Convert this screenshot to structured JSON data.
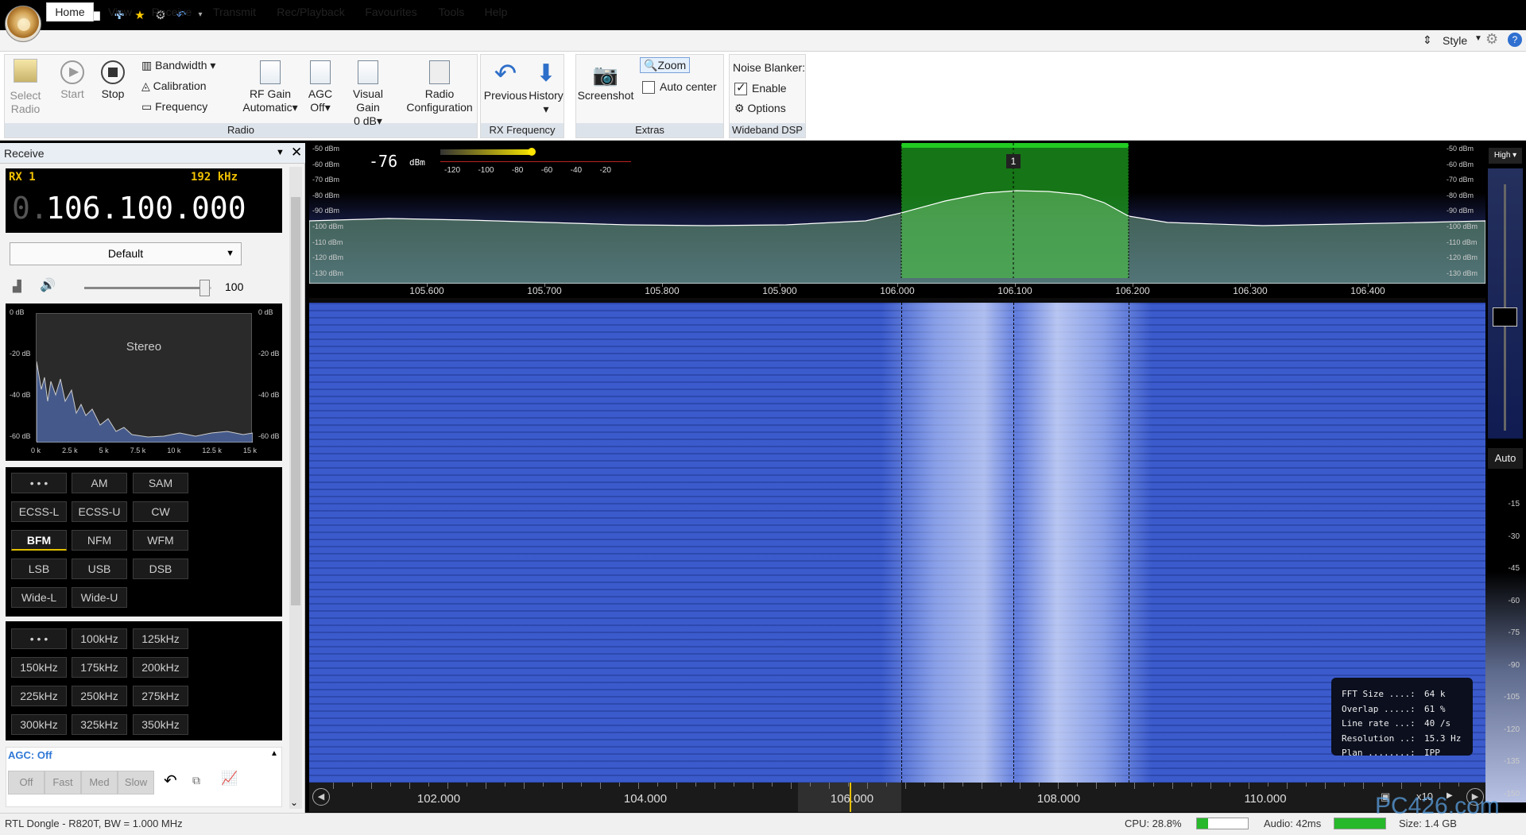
{
  "titlebar": {
    "quick_access": [
      "open-folder-icon",
      "play-icon",
      "stop-icon",
      "add-icon",
      "favourite-star-icon",
      "settings-icon",
      "undo-icon",
      "dropdown-icon"
    ]
  },
  "tabs": [
    "Home",
    "View",
    "Receive",
    "Transmit",
    "Rec/Playback",
    "Favourites",
    "Tools",
    "Help"
  ],
  "style_label": "Style",
  "ribbon": {
    "radio": {
      "select": "Select\nRadio",
      "start": "Start",
      "stop": "Stop",
      "bandwidth": "Bandwidth",
      "calibration": "Calibration",
      "frequency": "Frequency",
      "rfgain": "RF Gain",
      "rfgain_val": "Automatic",
      "agc": "AGC",
      "agc_val": "Off",
      "visual": "Visual Gain",
      "visual_val": "0 dB",
      "config1": "Radio",
      "config2": "Configuration",
      "group": "Radio"
    },
    "rx": {
      "previous": "Previous",
      "history": "History",
      "group": "RX Frequency"
    },
    "extras": {
      "screenshot": "Screenshot",
      "zoom": "Zoom",
      "autocenter": "Auto center",
      "group": "Extras"
    },
    "dsp": {
      "title": "Noise Blanker:",
      "enable": "Enable",
      "options": "Options",
      "group": "Wideband DSP"
    }
  },
  "receive": {
    "title": "Receive",
    "rx": "RX 1",
    "bw": "192 kHz",
    "freq_prefix": "0.",
    "freq": "106.100.000",
    "preset": "Default",
    "volume": "100",
    "volume_level": 0.95,
    "audio_spectrum": {
      "label": "Stereo",
      "left_ticks": [
        "0 dB",
        "-20 dB",
        "-40 dB",
        "-60 dB"
      ],
      "right_ticks": [
        "0 dB",
        "-20 dB",
        "-40 dB",
        "-60 dB"
      ],
      "x_ticks": [
        "0 k",
        "2.5 k",
        "5 k",
        "7.5 k",
        "10 k",
        "12.5 k",
        "15 k"
      ]
    },
    "modes": [
      "• • •",
      "AM",
      "SAM",
      "ECSS-L",
      "ECSS-U",
      "CW",
      "BFM",
      "NFM",
      "WFM",
      "LSB",
      "USB",
      "DSB",
      "Wide-L",
      "Wide-U"
    ],
    "selected_mode": "BFM",
    "steps": [
      "• • •",
      "100kHz",
      "125kHz",
      "150kHz",
      "175kHz",
      "200kHz",
      "225kHz",
      "250kHz",
      "275kHz",
      "300kHz",
      "325kHz",
      "350kHz"
    ],
    "agc": {
      "title": "AGC: Off",
      "buttons": [
        "Off",
        "Fast",
        "Med",
        "Slow"
      ]
    }
  },
  "spectrum": {
    "level": "-76",
    "level_unit": "dBm",
    "meter_ticks": [
      "-120",
      "-100",
      "-80",
      "-60",
      "-40",
      "-20"
    ],
    "db_ticks": [
      "-50 dBm",
      "-60 dBm",
      "-70 dBm",
      "-80 dBm",
      "-90 dBm",
      "-100 dBm",
      "-110 dBm",
      "-120 dBm",
      "-130 dBm"
    ],
    "freq_ticks": [
      "105.600",
      "105.700",
      "105.800",
      "105.900",
      "106.000",
      "106.100",
      "106.200",
      "106.300",
      "106.400"
    ],
    "marker": "1",
    "range_label": "High ▾"
  },
  "waterfall": {
    "freq_ticks": [
      "102.000",
      "104.000",
      "106.000",
      "108.000",
      "110.000"
    ],
    "zoom": "x10",
    "right_ticks": [
      "-15",
      "-30",
      "-45",
      "-60",
      "-75",
      "-90",
      "-105",
      "-120",
      "-135",
      "-150"
    ],
    "auto_label": "Auto",
    "info": [
      [
        "FFT Size ....:",
        "64 k"
      ],
      [
        "Overlap .....:",
        "61 %"
      ],
      [
        "Line rate ...:",
        "40 /s"
      ],
      [
        "Resolution ..:",
        "15.3 Hz"
      ],
      [
        "Plan ........:",
        "IPP"
      ]
    ]
  },
  "status": {
    "device": "RTL Dongle - R820T, BW = 1.000 MHz",
    "cpu": "CPU: 28.8%",
    "audio": "Audio: 42ms",
    "size": "Size: 1.4 GB",
    "watermark": "PC426.com"
  },
  "colors": {
    "signal_band": "#1e9c1e",
    "waterfall_bg": "#3b5bcc",
    "ribbon_group": "#dde3ea",
    "mode_sel": "#e3c000"
  }
}
